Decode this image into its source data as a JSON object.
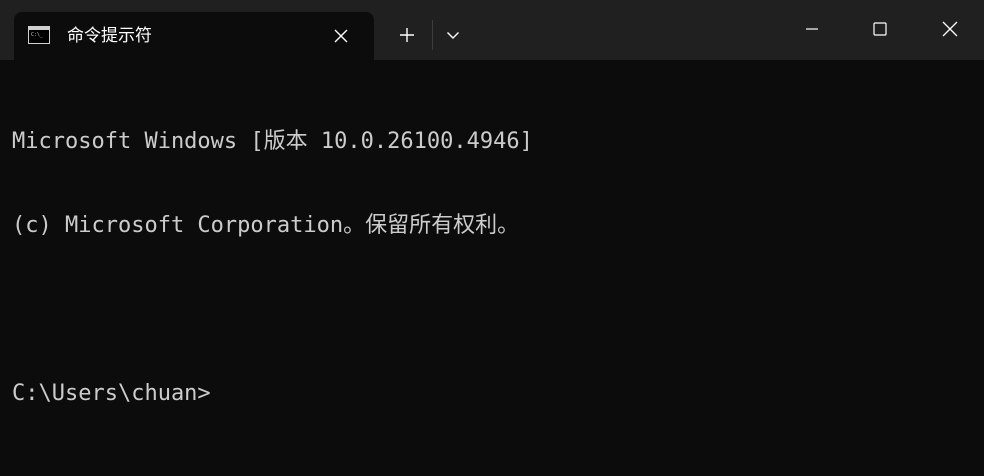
{
  "window": {
    "tab_title": "命令提示符",
    "icons": {
      "tab_icon": "terminal-icon",
      "tab_close": "close-icon",
      "new_tab": "plus-icon",
      "dropdown": "chevron-down-icon",
      "minimize": "minimize-icon",
      "maximize": "maximize-icon",
      "close": "close-icon"
    }
  },
  "console": {
    "lines": [
      "Microsoft Windows [版本 10.0.26100.4946]",
      "(c) Microsoft Corporation。保留所有权利。",
      "",
      "C:\\Users\\chuan>"
    ]
  },
  "colors": {
    "titlebar_bg": "#202020",
    "console_bg": "#0c0c0c",
    "console_text": "#cccccc",
    "title_text": "#ffffff"
  }
}
